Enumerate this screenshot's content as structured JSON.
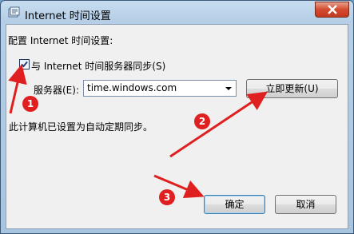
{
  "window": {
    "title": "Internet 时间设置",
    "close_icon": "close-icon"
  },
  "client": {
    "section_label": "配置 Internet 时间设置:",
    "sync_checkbox": {
      "label": "与 Internet 时间服务器同步(S)",
      "checked": true
    },
    "server": {
      "label": "服务器(E):",
      "value": "time.windows.com"
    },
    "update_now_label": "立即更新(U)",
    "status_text": "此计算机已设置为自动定期同步。",
    "ok_label": "确定",
    "cancel_label": "取消"
  },
  "annotations": {
    "markers": [
      "1",
      "2",
      "3"
    ],
    "color": "#e02020"
  }
}
